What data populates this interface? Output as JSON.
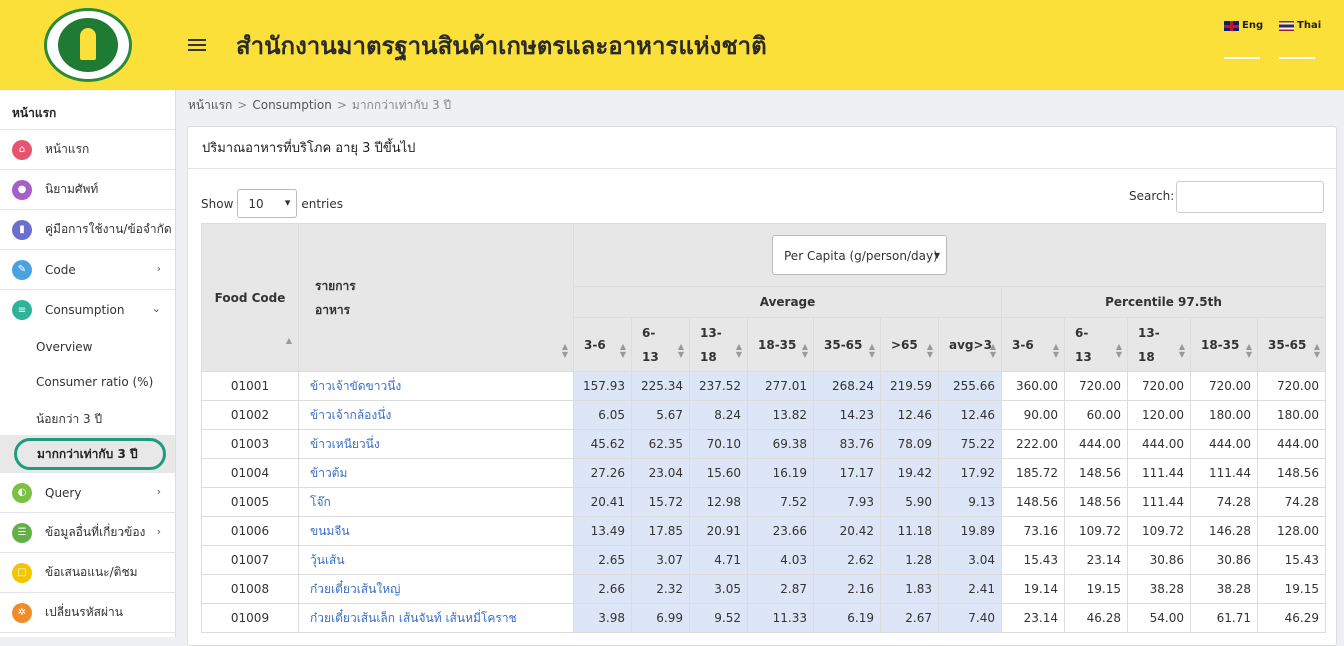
{
  "header": {
    "title": "สำนักงานมาตรฐานสินค้าเกษตรและอาหารแห่งชาติ",
    "lang_eng": "Eng",
    "lang_thai": "Thai",
    "accent": "#fbe03a"
  },
  "sidebar": {
    "heading": "หน้าแรก",
    "items": [
      {
        "label": "หน้าแรก",
        "icon": "home-icon",
        "color": "#e5556f"
      },
      {
        "label": "นิยามศัพท์",
        "icon": "lightbulb-icon",
        "color": "#a65fc7"
      },
      {
        "label": "คู่มือการใช้งาน/ข้อจำกัด",
        "icon": "book-icon",
        "color": "#6a6ecf"
      },
      {
        "label": "Code",
        "icon": "pen-icon",
        "color": "#4aa3df"
      },
      {
        "label": "Consumption",
        "icon": "list-icon",
        "color": "#2fb39a"
      },
      {
        "label": "Query",
        "icon": "query-icon",
        "color": "#7ac143"
      },
      {
        "label": "ข้อมูลอื่นที่เกี่ยวข้อง",
        "icon": "database-icon",
        "color": "#63b046"
      },
      {
        "label": "ข้อเสนอแนะ/ติชม",
        "icon": "comment-icon",
        "color": "#f2c500"
      },
      {
        "label": "เปลี่ยนรหัสผ่าน",
        "icon": "settings-icon",
        "color": "#f28c28"
      }
    ],
    "sub_items": [
      "Overview",
      "Consumer ratio (%)",
      "น้อยกว่า 3 ปี",
      "มากกว่าเท่ากับ 3 ปี"
    ]
  },
  "breadcrumb": {
    "home": "หน้าแรก",
    "section": "Consumption",
    "current": "มากกว่าเท่ากับ 3 ปี"
  },
  "card": {
    "title": "ปริมาณอาหารที่บริโภค อายุ 3 ปีขึ้นไป",
    "show_label": "Show",
    "entries_value": "10",
    "entries_label": "entries",
    "search_label": "Search:",
    "unit_select": "Per Capita (g/person/day)"
  },
  "table": {
    "col_food_code": "Food Code",
    "col_item_line1": "รายการ",
    "col_item_line2": "อาหาร",
    "group_average": "Average",
    "group_percentile": "Percentile 97.5th",
    "avg_headers": [
      [
        "3-6",
        ""
      ],
      [
        "6-",
        "13"
      ],
      [
        "13-",
        "18"
      ],
      [
        "18-35",
        ""
      ],
      [
        "35-65",
        ""
      ],
      [
        ">65",
        ""
      ],
      [
        "avg>3",
        ""
      ]
    ],
    "pct_headers": [
      [
        "3-6",
        ""
      ],
      [
        "6-",
        "13"
      ],
      [
        "13-",
        "18"
      ],
      [
        "18-35",
        ""
      ],
      [
        "35-65",
        ""
      ]
    ],
    "rows": [
      {
        "code": "01001",
        "name": "ข้าวเจ้าขัดขาวนึ่ง",
        "avg": [
          "157.93",
          "225.34",
          "237.52",
          "277.01",
          "268.24",
          "219.59",
          "255.66"
        ],
        "pct": [
          "360.00",
          "720.00",
          "720.00",
          "720.00",
          "720.00"
        ]
      },
      {
        "code": "01002",
        "name": "ข้าวเจ้ากล้องนึ่ง",
        "avg": [
          "6.05",
          "5.67",
          "8.24",
          "13.82",
          "14.23",
          "12.46",
          "12.46"
        ],
        "pct": [
          "90.00",
          "60.00",
          "120.00",
          "180.00",
          "180.00"
        ]
      },
      {
        "code": "01003",
        "name": "ข้าวเหนียวนึ่ง",
        "avg": [
          "45.62",
          "62.35",
          "70.10",
          "69.38",
          "83.76",
          "78.09",
          "75.22"
        ],
        "pct": [
          "222.00",
          "444.00",
          "444.00",
          "444.00",
          "444.00"
        ]
      },
      {
        "code": "01004",
        "name": "ข้าวต้ม",
        "avg": [
          "27.26",
          "23.04",
          "15.60",
          "16.19",
          "17.17",
          "19.42",
          "17.92"
        ],
        "pct": [
          "185.72",
          "148.56",
          "111.44",
          "111.44",
          "148.56"
        ]
      },
      {
        "code": "01005",
        "name": "โจ๊ก",
        "avg": [
          "20.41",
          "15.72",
          "12.98",
          "7.52",
          "7.93",
          "5.90",
          "9.13"
        ],
        "pct": [
          "148.56",
          "148.56",
          "111.44",
          "74.28",
          "74.28"
        ]
      },
      {
        "code": "01006",
        "name": "ขนมจีน",
        "avg": [
          "13.49",
          "17.85",
          "20.91",
          "23.66",
          "20.42",
          "11.18",
          "19.89"
        ],
        "pct": [
          "73.16",
          "109.72",
          "109.72",
          "146.28",
          "128.00"
        ]
      },
      {
        "code": "01007",
        "name": "วุ้นเส้น",
        "avg": [
          "2.65",
          "3.07",
          "4.71",
          "4.03",
          "2.62",
          "1.28",
          "3.04"
        ],
        "pct": [
          "15.43",
          "23.14",
          "30.86",
          "30.86",
          "15.43"
        ]
      },
      {
        "code": "01008",
        "name": "ก๋วยเตี๋ยวเส้นใหญ่",
        "avg": [
          "2.66",
          "2.32",
          "3.05",
          "2.87",
          "2.16",
          "1.83",
          "2.41"
        ],
        "pct": [
          "19.14",
          "19.15",
          "38.28",
          "38.28",
          "19.15"
        ]
      },
      {
        "code": "01009",
        "name": "ก๋วยเตี๋ยวเส้นเล็ก เส้นจันท์ เส้นหมี่โคราช",
        "avg": [
          "3.98",
          "6.99",
          "9.52",
          "11.33",
          "6.19",
          "2.67",
          "7.40"
        ],
        "pct": [
          "23.14",
          "46.28",
          "54.00",
          "61.71",
          "46.29"
        ]
      }
    ]
  }
}
